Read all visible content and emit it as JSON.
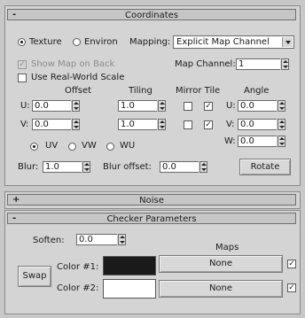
{
  "coordinates": {
    "header_title": "Coordinates",
    "header_sign": "-",
    "texture_label": "Texture",
    "environ_label": "Environ",
    "mapping_label": "Mapping:",
    "mapping_value": "Explicit Map Channel",
    "show_map_on_back": "Show Map on Back",
    "map_channel_label": "Map Channel:",
    "map_channel_value": "1",
    "use_real_world_scale": "Use Real-World Scale",
    "offset_label": "Offset",
    "tiling_label": "Tiling",
    "mirror_tile_label": "Mirror Tile",
    "angle_label": "Angle",
    "u_label": "U:",
    "v_label": "V:",
    "w_label": "W:",
    "u_offset": "0.0",
    "v_offset": "0.0",
    "u_tiling": "1.0",
    "v_tiling": "1.0",
    "u_angle": "0.0",
    "v_angle": "0.0",
    "w_angle": "0.0",
    "uv_label": "UV",
    "vw_label": "VW",
    "wu_label": "WU",
    "blur_label": "Blur:",
    "blur_value": "1.0",
    "blur_offset_label": "Blur offset:",
    "blur_offset_value": "0.0",
    "rotate_label": "Rotate",
    "checkmark": "✓"
  },
  "noise": {
    "header_title": "Noise",
    "header_sign": "+"
  },
  "checker": {
    "header_title": "Checker Parameters",
    "header_sign": "-",
    "soften_label": "Soften:",
    "soften_value": "0.0",
    "maps_label": "Maps",
    "swap_label": "Swap",
    "color1_label": "Color #1:",
    "color2_label": "Color #2:",
    "color1": "#1a1a1a",
    "color2": "#ffffff",
    "map1_label": "None",
    "map2_label": "None",
    "checkmark": "✓"
  }
}
